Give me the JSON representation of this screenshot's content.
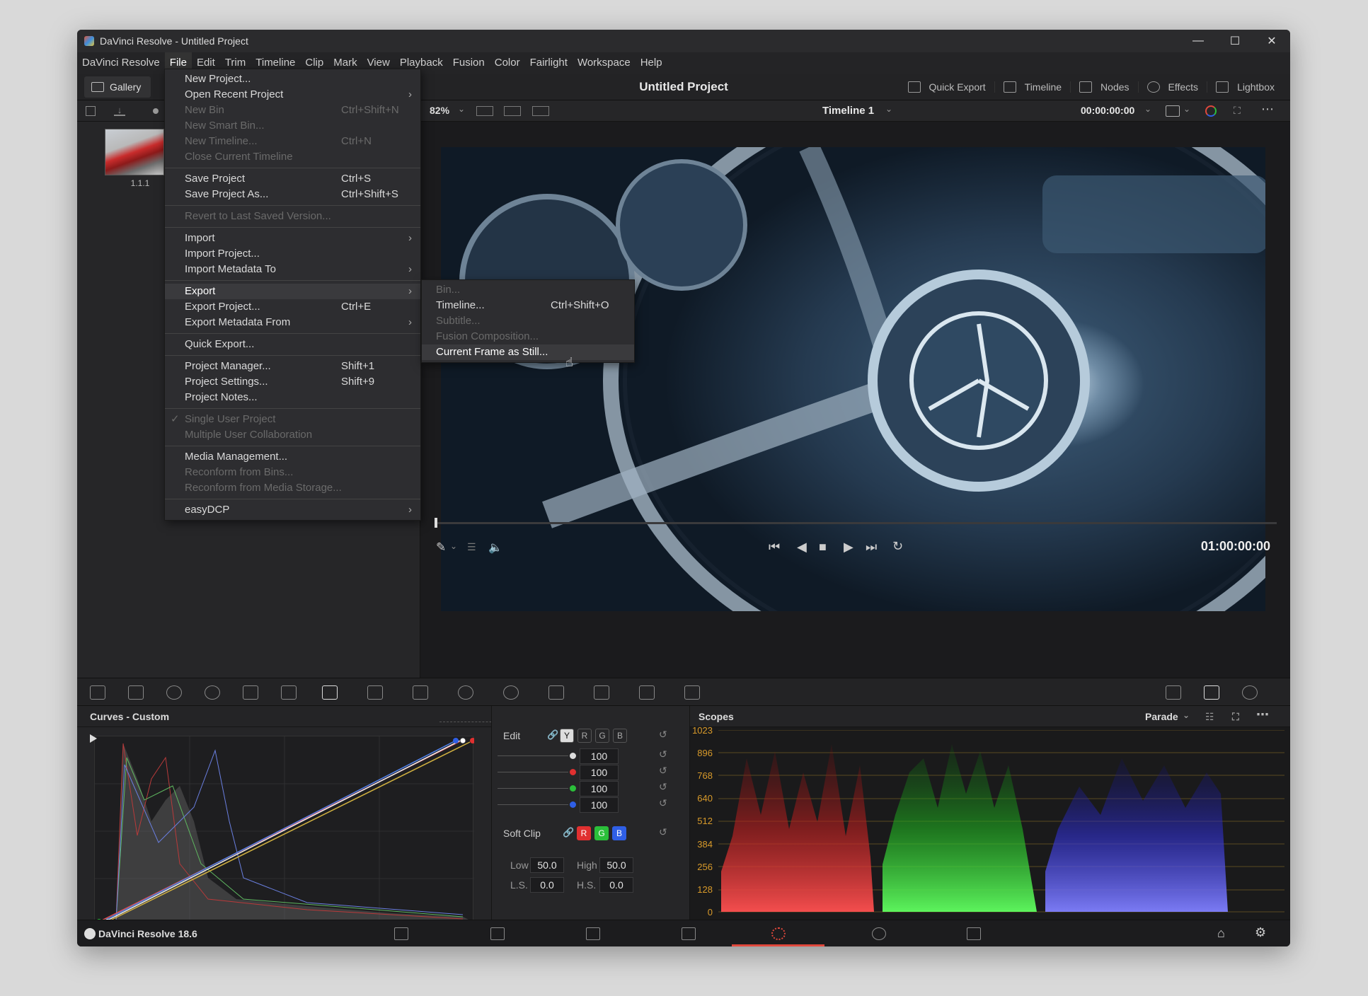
{
  "window": {
    "title": "DaVinci Resolve - Untitled Project",
    "controls": [
      "—",
      "☐",
      "✕"
    ]
  },
  "menubar": [
    "DaVinci Resolve",
    "File",
    "Edit",
    "Trim",
    "Timeline",
    "Clip",
    "Mark",
    "View",
    "Playback",
    "Fusion",
    "Color",
    "Fairlight",
    "Workspace",
    "Help"
  ],
  "topbar": {
    "gallery": "Gallery",
    "project_title": "Untitled Project",
    "tools": [
      "Quick Export",
      "Timeline",
      "Nodes",
      "Effects",
      "Lightbox"
    ]
  },
  "viewer": {
    "zoom": "82%",
    "timeline_name": "Timeline 1",
    "timecode_top": "00:00:00:00",
    "timecode_bottom": "01:00:00:00"
  },
  "media": {
    "thumb_label": "1.1.1"
  },
  "file_menu": [
    {
      "label": "New Project...",
      "shortcut": "",
      "disabled": false,
      "arrow": false
    },
    {
      "label": "Open Recent Project",
      "shortcut": "",
      "disabled": false,
      "arrow": true
    },
    {
      "label": "New Bin",
      "shortcut": "Ctrl+Shift+N",
      "disabled": true,
      "arrow": false
    },
    {
      "label": "New Smart Bin...",
      "shortcut": "",
      "disabled": true,
      "arrow": false
    },
    {
      "label": "New Timeline...",
      "shortcut": "Ctrl+N",
      "disabled": true,
      "arrow": false
    },
    {
      "label": "Close Current Timeline",
      "shortcut": "",
      "disabled": true,
      "arrow": false
    },
    {
      "sep": true
    },
    {
      "label": "Save Project",
      "shortcut": "Ctrl+S",
      "disabled": false,
      "arrow": false
    },
    {
      "label": "Save Project As...",
      "shortcut": "Ctrl+Shift+S",
      "disabled": false,
      "arrow": false
    },
    {
      "sep": true
    },
    {
      "label": "Revert to Last Saved Version...",
      "shortcut": "",
      "disabled": true,
      "arrow": false
    },
    {
      "sep": true
    },
    {
      "label": "Import",
      "shortcut": "",
      "disabled": false,
      "arrow": true
    },
    {
      "label": "Import Project...",
      "shortcut": "",
      "disabled": false,
      "arrow": false
    },
    {
      "label": "Import Metadata To",
      "shortcut": "",
      "disabled": false,
      "arrow": true
    },
    {
      "sep": true
    },
    {
      "label": "Export",
      "shortcut": "",
      "disabled": false,
      "arrow": true,
      "highlight": true
    },
    {
      "label": "Export Project...",
      "shortcut": "Ctrl+E",
      "disabled": false,
      "arrow": false
    },
    {
      "label": "Export Metadata From",
      "shortcut": "",
      "disabled": false,
      "arrow": true
    },
    {
      "sep": true
    },
    {
      "label": "Quick Export...",
      "shortcut": "",
      "disabled": false,
      "arrow": false
    },
    {
      "sep": true
    },
    {
      "label": "Project Manager...",
      "shortcut": "Shift+1",
      "disabled": false,
      "arrow": false
    },
    {
      "label": "Project Settings...",
      "shortcut": "Shift+9",
      "disabled": false,
      "arrow": false
    },
    {
      "label": "Project Notes...",
      "shortcut": "",
      "disabled": false,
      "arrow": false
    },
    {
      "sep": true
    },
    {
      "label": "Single User Project",
      "shortcut": "",
      "disabled": true,
      "arrow": false,
      "check": true
    },
    {
      "label": "Multiple User Collaboration",
      "shortcut": "",
      "disabled": true,
      "arrow": false
    },
    {
      "sep": true
    },
    {
      "label": "Media Management...",
      "shortcut": "",
      "disabled": false,
      "arrow": false
    },
    {
      "label": "Reconform from Bins...",
      "shortcut": "",
      "disabled": true,
      "arrow": false
    },
    {
      "label": "Reconform from Media Storage...",
      "shortcut": "",
      "disabled": true,
      "arrow": false
    },
    {
      "sep": true
    },
    {
      "label": "easyDCP",
      "shortcut": "",
      "disabled": false,
      "arrow": true
    }
  ],
  "export_submenu": [
    {
      "label": "Bin...",
      "shortcut": "",
      "disabled": true
    },
    {
      "label": "Timeline...",
      "shortcut": "Ctrl+Shift+O",
      "disabled": false
    },
    {
      "label": "Subtitle...",
      "shortcut": "",
      "disabled": true
    },
    {
      "label": "Fusion Composition...",
      "shortcut": "",
      "disabled": true
    },
    {
      "label": "Current Frame as Still...",
      "shortcut": "",
      "disabled": false,
      "highlight": true
    }
  ],
  "curves": {
    "title": "Curves - Custom"
  },
  "edit": {
    "label": "Edit",
    "channels": [
      "Y",
      "R",
      "G",
      "B"
    ],
    "values": [
      "100",
      "100",
      "100",
      "100"
    ],
    "soft_clip_label": "Soft Clip",
    "soft_clip_channels": [
      "R",
      "G",
      "B"
    ],
    "low_label": "Low",
    "low": "50.0",
    "high_label": "High",
    "high": "50.0",
    "ls_label": "L.S.",
    "ls": "0.0",
    "hs_label": "H.S.",
    "hs": "0.0"
  },
  "scopes": {
    "title": "Scopes",
    "mode": "Parade",
    "ticks": [
      "1023",
      "896",
      "768",
      "640",
      "512",
      "384",
      "256",
      "128",
      "0"
    ]
  },
  "statusbar": {
    "brand": "DaVinci Resolve 18.6"
  },
  "colors": {
    "accent": "#e0483c",
    "red": "#e03030",
    "green": "#2bbf3a",
    "blue": "#2f5fe6"
  }
}
